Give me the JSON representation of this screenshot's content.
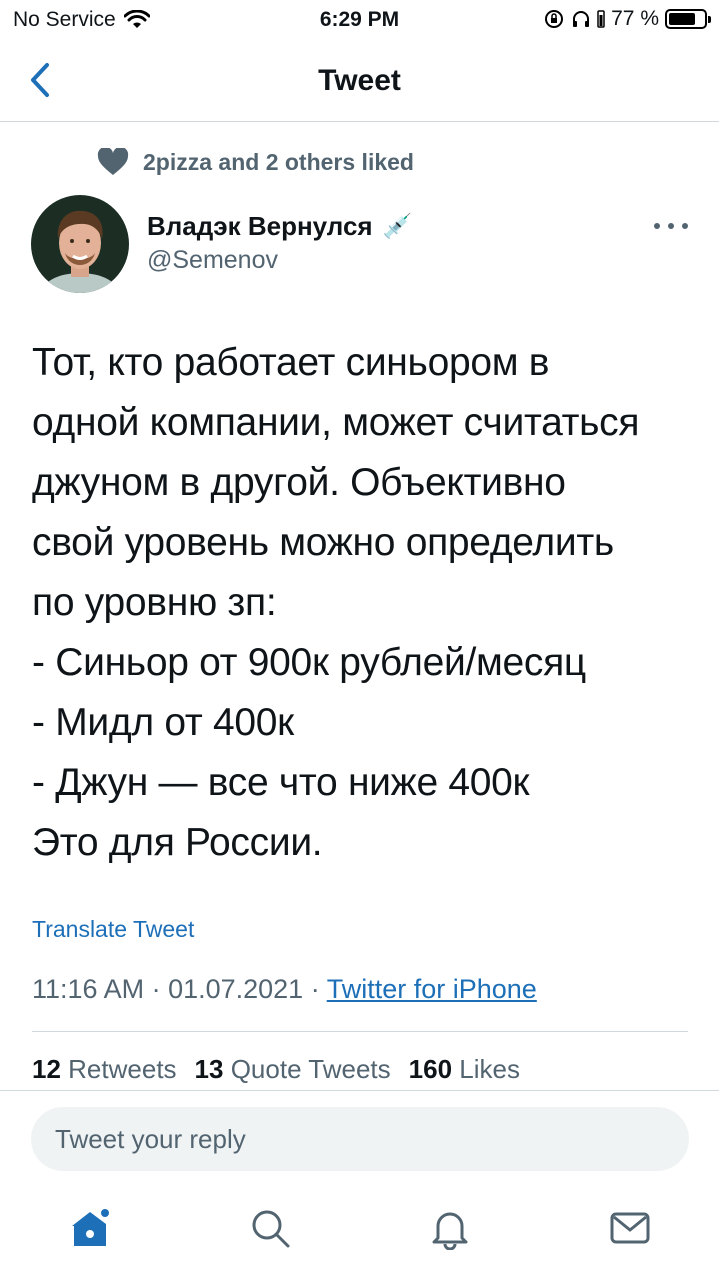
{
  "status_bar": {
    "carrier": "No Service",
    "time": "6:29 PM",
    "battery_percent": "77 %",
    "battery_level": 0.77
  },
  "nav": {
    "title": "Tweet",
    "back_icon": "chevron-left-icon"
  },
  "social_context": {
    "icon": "heart-icon",
    "text": "2pizza and 2 others liked"
  },
  "author": {
    "name": "Владэк Вернулся",
    "emoji": "💉",
    "handle": "@Semenov"
  },
  "tweet": {
    "lines": [
      "Тот, кто работает синьором в",
      "одной компании, может считаться",
      "джуном в другой. Объективно",
      "свой уровень можно определить",
      "по уровню зп:",
      "- Синьор от 900к рублей/месяц",
      "- Мидл от 400к",
      "- Джун — все что ниже 400к",
      "Это для России."
    ],
    "translate_label": "Translate Tweet",
    "timestamp": "11:16 AM · 01.07.2021 · ",
    "source": "Twitter for iPhone"
  },
  "stats": {
    "retweets_count": "12",
    "retweets_label": "Retweets",
    "quotes_count": "13",
    "quotes_label": "Quote Tweets",
    "likes_count": "160",
    "likes_label": "Likes"
  },
  "reply": {
    "placeholder": "Tweet your reply"
  },
  "tabbar": {
    "items": [
      "home-icon",
      "search-icon",
      "notifications-icon",
      "messages-icon"
    ],
    "accent": "#1d6fb8"
  }
}
